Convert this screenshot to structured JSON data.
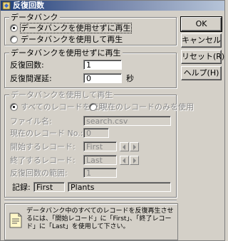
{
  "window": {
    "title": "反復回数"
  },
  "playback": {
    "legend": "データバンク",
    "opt_without": "データバンクを使用せずに再生",
    "opt_with": "データバンクを使用して再生"
  },
  "without_group": {
    "legend": "データバンクを使用せずに再生",
    "repeat_label": "反復回数:",
    "repeat_value": "1",
    "delay_label": "反復間遅延:",
    "delay_value": "0",
    "delay_unit": "秒"
  },
  "with_group": {
    "legend": "データバンクを使用して再生",
    "opt_all": "すべてのレコードを使用",
    "opt_current": "現在のレコードのみを使用",
    "file_label": "ファイル名:",
    "file_value": "search.csv",
    "current_label": "現在のレコード No.:",
    "current_value": "0",
    "start_label": "開始するレコード:",
    "start_value": "First",
    "end_label": "終了するレコード:",
    "end_value": "Last",
    "range_label": "反復回数の範囲:",
    "range_value": "1",
    "record_label": "記録:",
    "record_value": "First",
    "record_name": "Plants"
  },
  "buttons": {
    "ok": "OK",
    "cancel": "キャンセル",
    "reset": "リセット(R)",
    "help": "ヘルプ(H)"
  },
  "info": {
    "text": "データバンク中のすべてのレコードを反復再生させるには、「開始レコード」に「First」、「終了レコード」に「Last」を使用して下さい。"
  }
}
